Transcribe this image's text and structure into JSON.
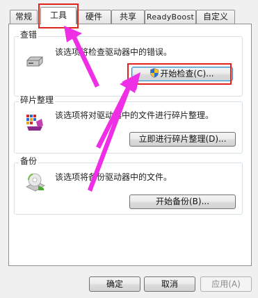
{
  "tabs": [
    {
      "label": "常规"
    },
    {
      "label": "工具",
      "active": true
    },
    {
      "label": "硬件"
    },
    {
      "label": "共享"
    },
    {
      "label": "ReadyBoost"
    },
    {
      "label": "自定义"
    }
  ],
  "check": {
    "title": "查错",
    "description": "该选项将检查驱动器中的错误。",
    "button": "开始检查(C)...",
    "icon": "drive-icon"
  },
  "defrag": {
    "title": "碎片整理",
    "description": "该选项将对驱动器中的文件进行碎片整理。",
    "button": "立即进行碎片整理(D)...",
    "icon": "defrag-icon"
  },
  "backup": {
    "title": "备份",
    "description": "该选项将备份驱动器中的文件。",
    "button": "开始备份(B)...",
    "icon": "backup-icon"
  },
  "footer": {
    "ok": "确定",
    "cancel": "取消",
    "apply": "应用(A)"
  },
  "colors": {
    "highlight": "#e2231a",
    "arrow": "#ee2fe6"
  }
}
